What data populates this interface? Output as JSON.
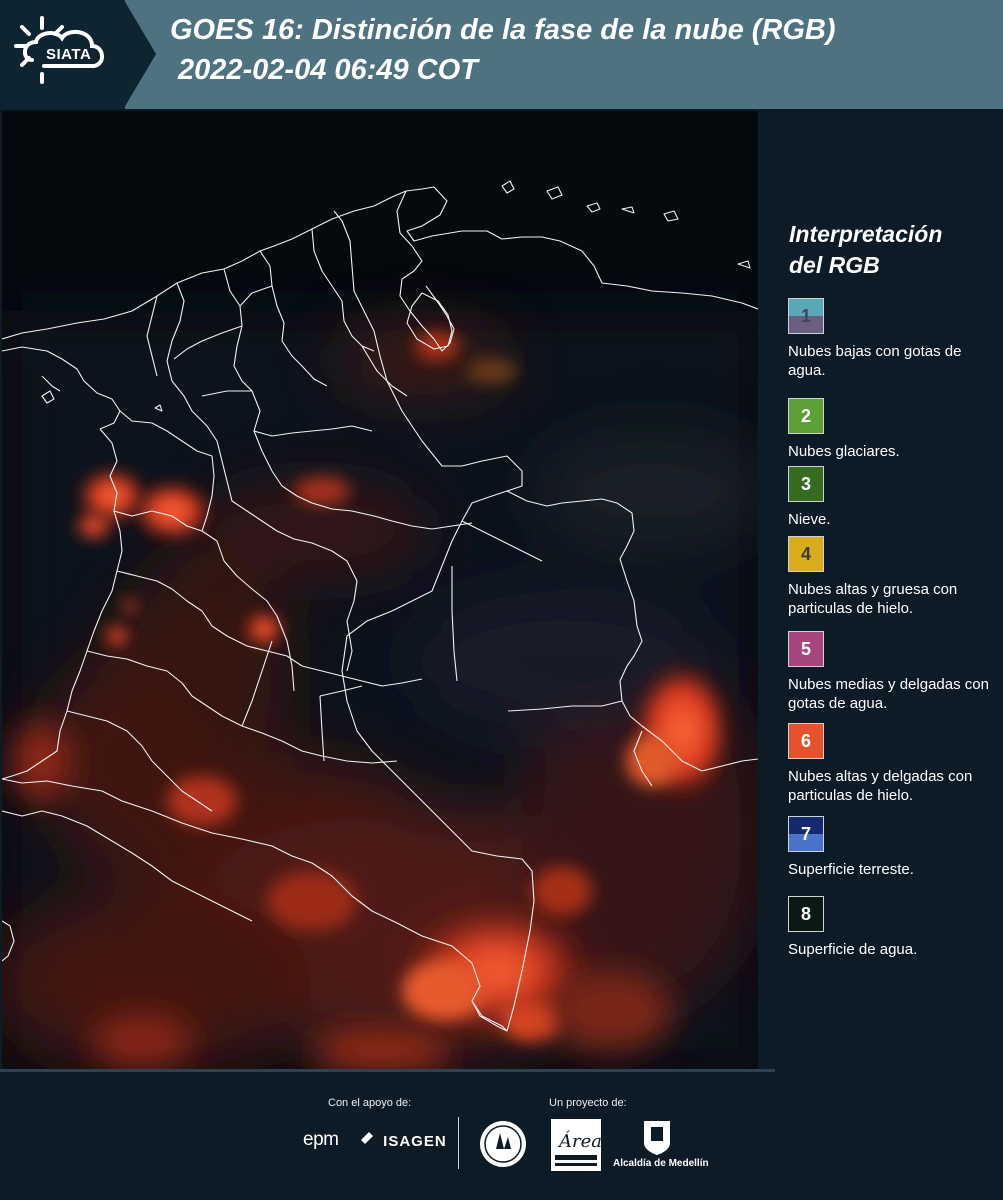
{
  "header": {
    "logo_text": "SIATA",
    "title": "GOES 16: Distinción de la fase de la nube (RGB)",
    "subtitle": "2022-02-04 06:49 COT"
  },
  "legend": {
    "title_line1": "Interpretación",
    "title_line2": "del RGB",
    "items": [
      {
        "num": "1",
        "label": "Nubes bajas con gotas de agua.",
        "color_top": "#5aa7b7",
        "color_bottom": "#6a5f7f",
        "num_color": "#3b4a5c"
      },
      {
        "num": "2",
        "label": "Nubes glaciares.",
        "color_top": "#5da036",
        "color_bottom": "#5da036",
        "num_color": "#ffffff"
      },
      {
        "num": "3",
        "label": "Nieve.",
        "color_top": "#356c1f",
        "color_bottom": "#356c1f",
        "num_color": "#ffffff"
      },
      {
        "num": "4",
        "label": "Nubes altas y gruesa con particulas de hielo.",
        "color_top": "#d9ac1c",
        "color_bottom": "#d9ac1c",
        "num_color": "#3b3b3b"
      },
      {
        "num": "5",
        "label": "Nubes medias y delgadas con gotas de agua.",
        "color_top": "#a8457d",
        "color_bottom": "#a8457d",
        "num_color": "#ffffff"
      },
      {
        "num": "6",
        "label": "Nubes altas y delgadas con particulas de hielo.",
        "color_top": "#e4532c",
        "color_bottom": "#e4532c",
        "num_color": "#ffffff"
      },
      {
        "num": "7",
        "label": "Superficie terreste.",
        "color_top": "#152a6e",
        "color_bottom": "#4a73c9",
        "num_color": "#ffffff"
      },
      {
        "num": "8",
        "label": "Superficie de agua.",
        "color_top": "#0a1a12",
        "color_bottom": "#0a1a12",
        "num_color": "#ffffff"
      }
    ]
  },
  "footer": {
    "support_label": "Con el apoyo de:",
    "project_label": "Un proyecto de:",
    "sponsors": [
      "epm",
      "ISAGEN"
    ],
    "partners": [
      "Area Metropolitana Valle de Aburrá",
      "Alcaldía de Medellín"
    ],
    "medellin_text": "Alcaldía de Medellín"
  }
}
